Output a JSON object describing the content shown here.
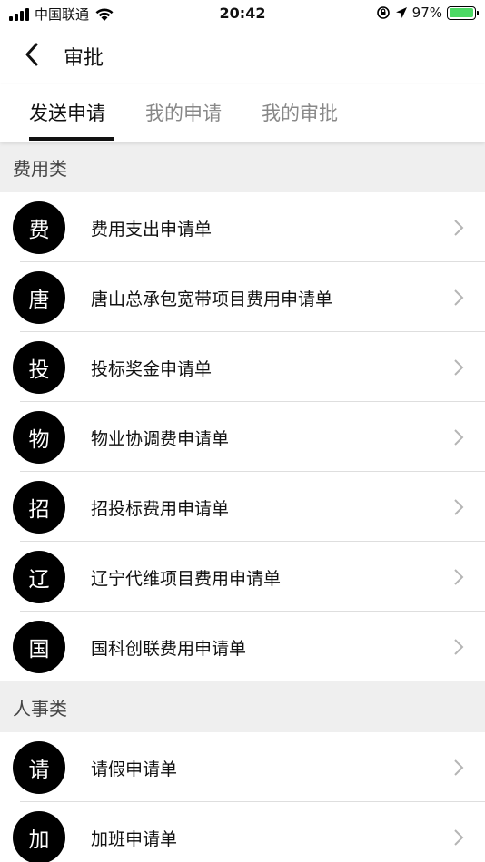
{
  "status_bar": {
    "carrier": "中国联通",
    "time": "20:42",
    "battery_percent": "97%",
    "battery_level": 0.97,
    "battery_color": "#4cd964"
  },
  "nav": {
    "title": "审批",
    "back_icon": "chevron-left-icon"
  },
  "tabs": [
    {
      "label": "发送申请",
      "active": true
    },
    {
      "label": "我的申请",
      "active": false
    },
    {
      "label": "我的审批",
      "active": false
    }
  ],
  "sections": [
    {
      "title": "费用类",
      "items": [
        {
          "avatar": "费",
          "label": "费用支出申请单"
        },
        {
          "avatar": "唐",
          "label": "唐山总承包宽带项目费用申请单"
        },
        {
          "avatar": "投",
          "label": "投标奖金申请单"
        },
        {
          "avatar": "物",
          "label": "物业协调费申请单"
        },
        {
          "avatar": "招",
          "label": "招投标费用申请单"
        },
        {
          "avatar": "辽",
          "label": "辽宁代维项目费用申请单"
        },
        {
          "avatar": "国",
          "label": "国科创联费用申请单"
        }
      ]
    },
    {
      "title": "人事类",
      "items": [
        {
          "avatar": "请",
          "label": "请假申请单"
        },
        {
          "avatar": "加",
          "label": "加班申请单"
        }
      ]
    }
  ]
}
